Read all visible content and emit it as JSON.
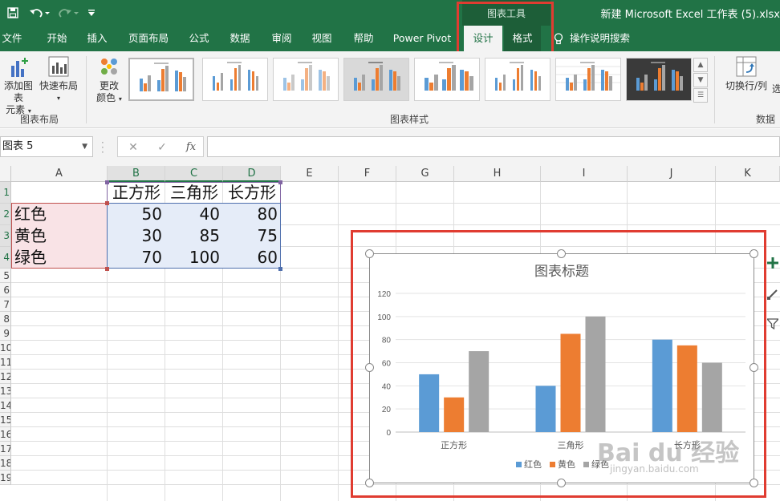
{
  "title_bar": {
    "document_title": "新建 Microsoft Excel 工作表 (5).xlsx",
    "contextual_group": "图表工具"
  },
  "ribbon_tabs": [
    {
      "label": "文件"
    },
    {
      "label": "开始"
    },
    {
      "label": "插入"
    },
    {
      "label": "页面布局"
    },
    {
      "label": "公式"
    },
    {
      "label": "数据"
    },
    {
      "label": "审阅"
    },
    {
      "label": "视图"
    },
    {
      "label": "帮助"
    },
    {
      "label": "Power Pivot"
    },
    {
      "label": "设计"
    },
    {
      "label": "格式"
    }
  ],
  "active_tab": "设计",
  "tell_me": "操作说明搜索",
  "ribbon": {
    "add_chart_element_1": "添加图表",
    "add_chart_element_2": "元素",
    "quick_layout": "快速布局",
    "change_colors_1": "更改",
    "change_colors_2": "颜色",
    "switch_row_col": "切换行/列",
    "select_data_partial": "选",
    "group_layout": "图表布局",
    "group_styles": "图表样式",
    "group_data": "数据"
  },
  "formula_bar": {
    "name_box": "图表 5",
    "fx": "fx",
    "cancel": "✕",
    "enter": "✓",
    "value": ""
  },
  "sheet": {
    "columns": [
      "A",
      "B",
      "C",
      "D",
      "E",
      "F",
      "G",
      "H",
      "I",
      "J",
      "K"
    ],
    "rows": [
      "1",
      "2",
      "3",
      "4",
      "5",
      "6",
      "7",
      "8",
      "9",
      "10",
      "11",
      "12",
      "13",
      "14",
      "15",
      "16",
      "17",
      "18",
      "19"
    ],
    "header_row": [
      "正方形",
      "三角形",
      "长方形"
    ],
    "data_rows": [
      {
        "label": "红色",
        "values": [
          "50",
          "40",
          "80"
        ]
      },
      {
        "label": "黄色",
        "values": [
          "30",
          "85",
          "75"
        ]
      },
      {
        "label": "绿色",
        "values": [
          "70",
          "100",
          "60"
        ]
      }
    ]
  },
  "chart_data": {
    "type": "bar",
    "title": "图表标题",
    "categories": [
      "正方形",
      "三角形",
      "长方形"
    ],
    "series": [
      {
        "name": "红色",
        "values": [
          50,
          40,
          80
        ],
        "color": "#5b9bd5"
      },
      {
        "name": "黄色",
        "values": [
          30,
          85,
          75
        ],
        "color": "#ed7d31"
      },
      {
        "name": "绿色",
        "values": [
          70,
          100,
          60
        ],
        "color": "#a5a5a5"
      }
    ],
    "ylim": [
      0,
      120
    ],
    "yticks": [
      "0",
      "20",
      "40",
      "60",
      "80",
      "100",
      "120"
    ],
    "grid": true,
    "legend": "bottom",
    "xlabel": "",
    "ylabel": ""
  },
  "watermark": {
    "brand": "Bai du 经验",
    "url": "jingyan.baidu.com"
  },
  "colors": {
    "excel_green": "#217346",
    "highlight_red": "#e03c31"
  }
}
